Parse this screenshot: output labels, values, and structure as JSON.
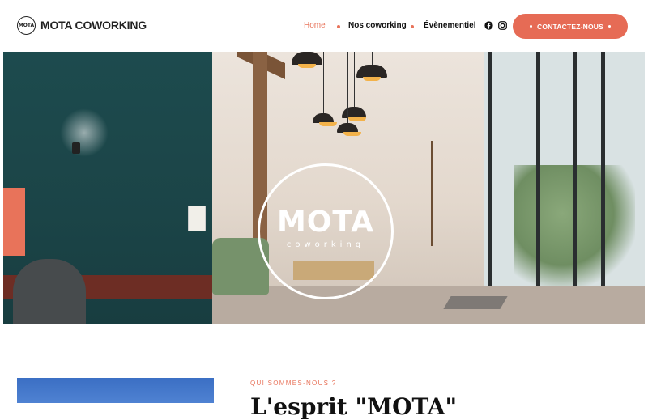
{
  "header": {
    "logo_text": "MOTA",
    "brand": "MOTA COWORKING",
    "nav": [
      {
        "label": "Home",
        "active": true
      },
      {
        "label": "Nos coworking",
        "active": false
      },
      {
        "label": "Évènementiel",
        "active": false
      }
    ],
    "social": [
      "facebook-icon",
      "instagram-icon"
    ],
    "cta_label": "CONTACTEZ-NOUS"
  },
  "hero": {
    "logo_title": "MOTA",
    "logo_subtitle": "coworking"
  },
  "about": {
    "eyebrow": "QUI SOMMES-NOUS ?",
    "title": "L'esprit \"MOTA\""
  },
  "colors": {
    "accent": "#e8735a",
    "text": "#111111",
    "teal_wall": "#1d4b4e"
  }
}
